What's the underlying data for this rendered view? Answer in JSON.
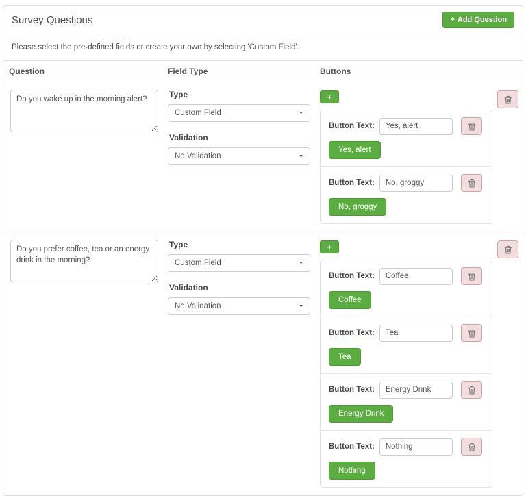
{
  "colors": {
    "accent_green": "#5bac41",
    "accent_green_border": "#4c9a35",
    "danger_bg": "#f2dede",
    "danger_border": "#d4a2a2",
    "trash_icon": "#777777"
  },
  "icons": {
    "plus": "+",
    "caret": "▼"
  },
  "panel": {
    "title": "Survey Questions",
    "subtitle": "Please select the pre-defined fields or create your own by selecting 'Custom Field'.",
    "add_question": {
      "icon": "+",
      "label": "Add Question"
    }
  },
  "table": {
    "headers": {
      "question": "Question",
      "field_type": "Field Type",
      "buttons": "Buttons"
    }
  },
  "labels": {
    "type": "Type",
    "validation": "Validation",
    "button_text": "Button Text:"
  },
  "questions": [
    {
      "question": "Do you wake up in the morning alert?",
      "type_value": "Custom Field",
      "validation_value": "No Validation",
      "buttons": [
        {
          "text": "Yes, alert"
        },
        {
          "text": "No, groggy"
        }
      ]
    },
    {
      "question": "Do you prefer coffee, tea or an energy drink in the morning?",
      "type_value": "Custom Field",
      "validation_value": "No Validation",
      "buttons": [
        {
          "text": "Coffee"
        },
        {
          "text": "Tea"
        },
        {
          "text": "Energy Drink"
        },
        {
          "text": "Nothing"
        }
      ]
    }
  ]
}
